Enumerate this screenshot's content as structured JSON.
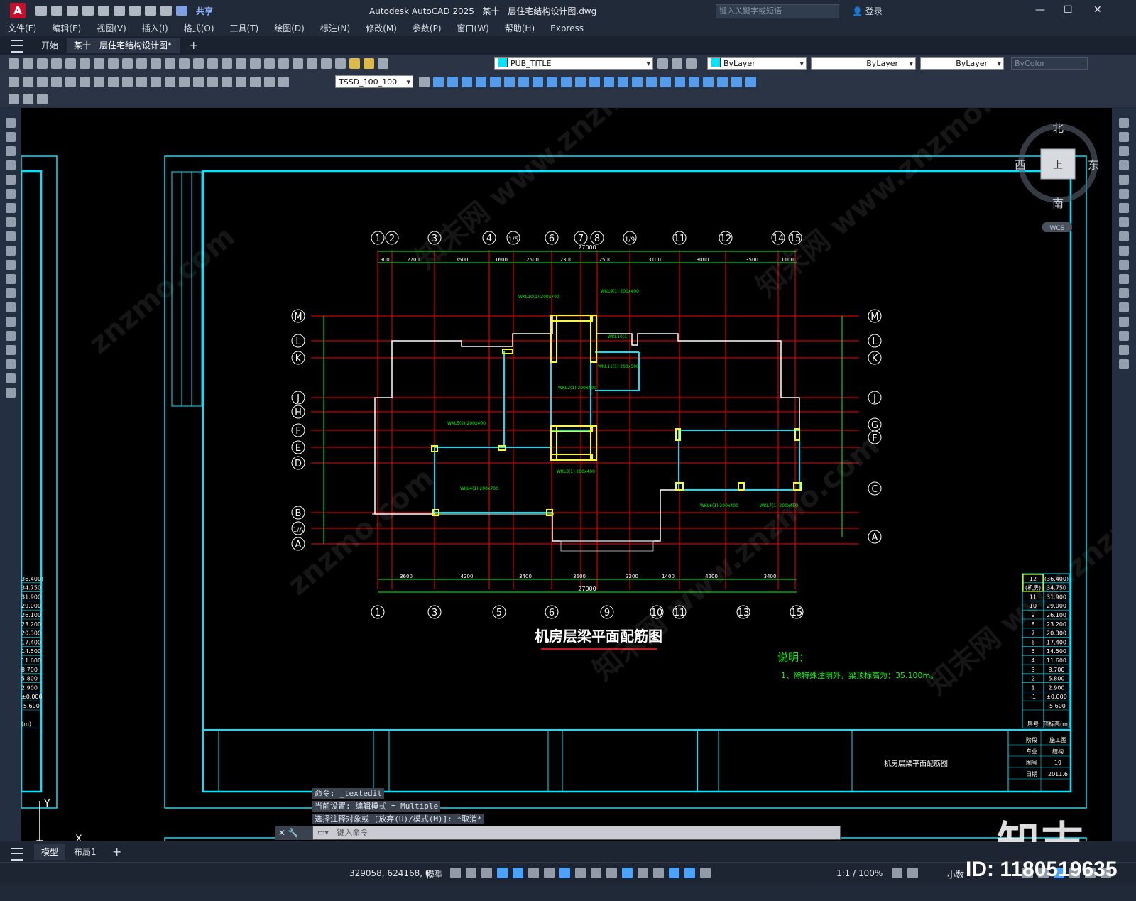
{
  "app": {
    "title": "Autodesk AutoCAD 2025",
    "document": "某十一层住宅结构设计图.dwg",
    "share_label": "共享",
    "search_placeholder": "键入关键字或短语",
    "login_label": "登录"
  },
  "menus": [
    "文件(F)",
    "编辑(E)",
    "视图(V)",
    "插入(I)",
    "格式(O)",
    "工具(T)",
    "绘图(D)",
    "标注(N)",
    "修改(M)",
    "参数(P)",
    "窗口(W)",
    "帮助(H)",
    "Express"
  ],
  "tabs": {
    "start": "开始",
    "document": "某十一层住宅结构设计图*",
    "add": "+"
  },
  "toolbar": {
    "layer_combo": "PUB_TITLE",
    "color_combo": "ByLayer",
    "linetype_combo": "ByLayer",
    "lineweight_combo": "ByLayer",
    "plotstyle_combo": "ByColor",
    "dimstyle_combo": "TSSD_100_100"
  },
  "viewcube": {
    "north": "北",
    "south": "南",
    "east": "东",
    "west": "西",
    "top": "上",
    "wcs": "WCS"
  },
  "drawing": {
    "title": "机房层梁平面配筋图",
    "note_title": "说明：",
    "note_text": "1、除特殊注明外，梁顶标高为：35.100m。",
    "titleblock_name": "机房层梁平面配筋图",
    "total_dim": "27000",
    "top_axes": [
      "1",
      "2",
      "3",
      "4",
      "1/5",
      "6",
      "7",
      "8",
      "1/9",
      "11",
      "12",
      "14",
      "15"
    ],
    "bottom_axes": [
      "1",
      "3",
      "5",
      "6",
      "9",
      "10",
      "11",
      "13",
      "15"
    ],
    "left_axes": [
      "M",
      "L",
      "K",
      "J",
      "H",
      "F",
      "E",
      "D",
      "B",
      "1/A",
      "A"
    ],
    "right_axes": [
      "M",
      "L",
      "K",
      "J",
      "G",
      "F",
      "C",
      "A"
    ],
    "top_dims": [
      "900",
      "2700",
      "3500",
      "1600",
      "2500",
      "2300",
      "2500",
      "3100",
      "3000",
      "3500",
      "1100"
    ],
    "bottom_dims": [
      "3600",
      "4200",
      "3400",
      "3600",
      "3200",
      "1400",
      "4200",
      "3400"
    ],
    "level_table": [
      [
        "12",
        "(36.400)"
      ],
      [
        "(机房)",
        "34.750"
      ],
      [
        "11",
        "31.900"
      ],
      [
        "10",
        "29.000"
      ],
      [
        "9",
        "26.100"
      ],
      [
        "8",
        "23.200"
      ],
      [
        "7",
        "20.300"
      ],
      [
        "6",
        "17.400"
      ],
      [
        "5",
        "14.500"
      ],
      [
        "4",
        "11.600"
      ],
      [
        "3",
        "8.700"
      ],
      [
        "2",
        "5.800"
      ],
      [
        "1",
        "2.900"
      ],
      [
        "-1",
        "±0.000"
      ],
      [
        "",
        "-5.600"
      ],
      [
        "层号",
        "顶标高(m)"
      ]
    ],
    "titleblock_rows": [
      [
        "阶段",
        "施工图"
      ],
      [
        "专业",
        "结构"
      ],
      [
        "图号",
        "19"
      ],
      [
        "日期",
        "2011.6"
      ]
    ],
    "left_partial_levels": [
      "36.400)",
      "34.750",
      "31.900",
      "29.000",
      "26.100",
      "23.200",
      "20.300",
      "17.400",
      "14.500",
      "11.600",
      "8.700",
      "5.800",
      "2.900",
      "±0.000",
      "-5.600",
      "(m)"
    ]
  },
  "command": {
    "line1": "命令: _textedit",
    "line2": "当前设置: 编辑模式 = Multiple",
    "line3": "选择注释对象或 [放弃(U)/模式(M)]: *取消*",
    "placeholder": "键入命令"
  },
  "layout_tabs": {
    "model": "模型",
    "layout1": "布局1",
    "add": "+"
  },
  "status": {
    "coords": "329058, 624168, 0",
    "model": "模型",
    "scale": "1:1 / 100%",
    "units": "小数"
  },
  "watermark": {
    "logo": "知末",
    "id": "ID: 1180519635"
  },
  "colors": {
    "cyan": "#00e5ff",
    "green": "#00ff00",
    "red": "#ff0000",
    "yellow": "#ffff00",
    "white": "#ffffff"
  }
}
